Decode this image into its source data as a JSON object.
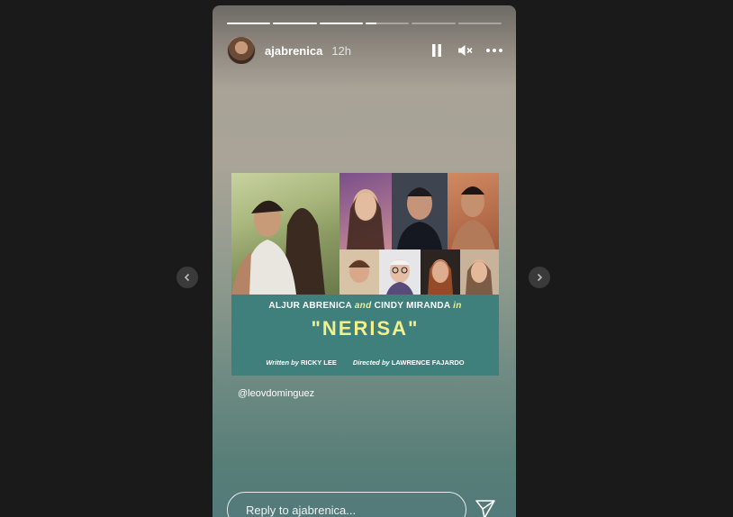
{
  "story": {
    "username": "ajabrenica",
    "time": "12h",
    "progress": [
      1,
      1,
      1,
      0.25,
      0,
      0
    ]
  },
  "poster": {
    "caption": {
      "name1": "ALJUR ABRENICA",
      "and": "and",
      "name2": "CINDY MIRANDA",
      "in": "in"
    },
    "title": "\"NERISA\"",
    "written_by_label": "Written by",
    "writer": "RICKY LEE",
    "directed_by_label": "Directed by",
    "director": "LAWRENCE FAJARDO"
  },
  "mention": "@leovdominguez",
  "reply": {
    "placeholder": "Reply to ajabrenica..."
  },
  "colors": {
    "page_bg": "#1a1a1a",
    "poster_band": "#3f7f7c",
    "title_yellow": "#f3f08c"
  },
  "icons": [
    "pause-icon",
    "mute-icon",
    "more-icon",
    "send-icon",
    "chevron-left-icon",
    "chevron-right-icon"
  ]
}
